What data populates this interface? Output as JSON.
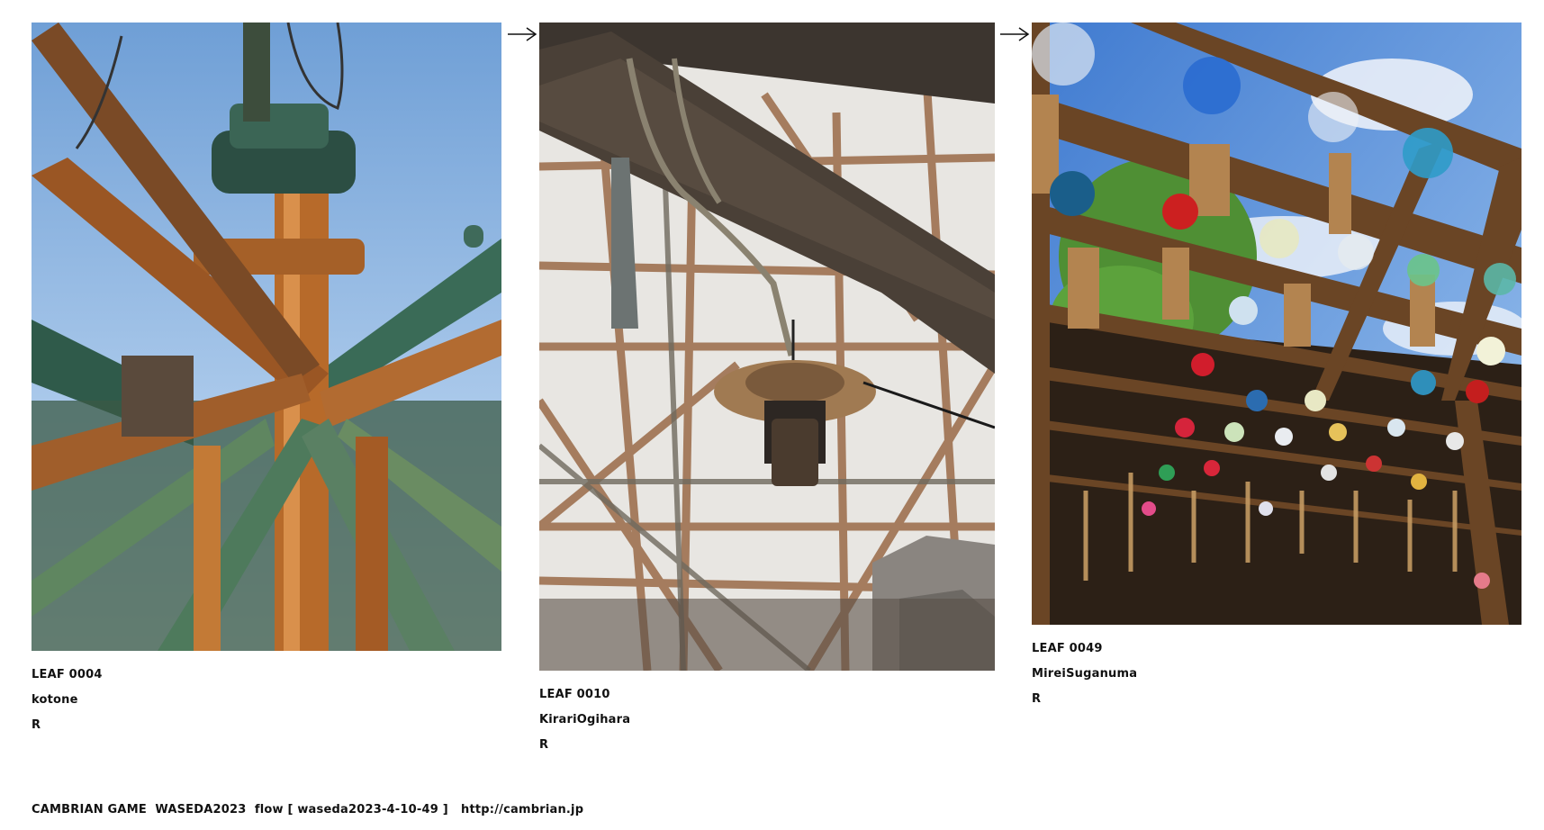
{
  "leaves": [
    {
      "id_label": "LEAF 0004",
      "author": "kotone",
      "mark": "R",
      "photo_icon": "steel-tower-photo"
    },
    {
      "id_label": "LEAF 0010",
      "author": "KirariOgihara",
      "mark": "R",
      "photo_icon": "lantern-beam-photo"
    },
    {
      "id_label": "LEAF 0049",
      "author": "MireiSuganuma",
      "mark": "R",
      "photo_icon": "wind-chimes-photo"
    }
  ],
  "arrows": [
    "arrow-right-icon",
    "arrow-right-icon"
  ],
  "footer": {
    "text": "CAMBRIAN GAME  WASEDA2023  flow [ waseda2023-4-10-49 ]   http://cambrian.jp"
  },
  "colors": {
    "text": "#111111",
    "background": "#ffffff"
  }
}
